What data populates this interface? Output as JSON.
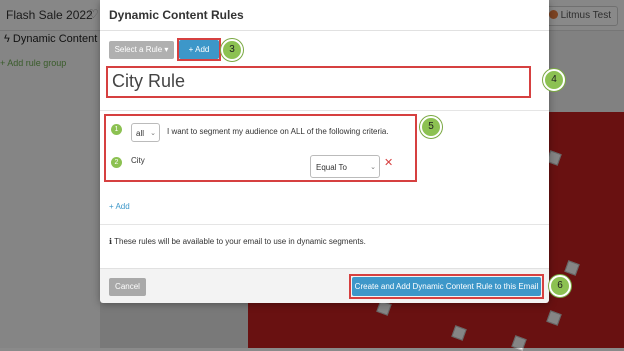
{
  "background": {
    "title": "Flash Sale 2022",
    "left_heading": "Dynamic Content",
    "add_rule_group": "Add rule group",
    "litmus_label": "Litmus Test"
  },
  "modal": {
    "title": "Dynamic Content Rules",
    "select_rule_label": "Select a Rule",
    "add_label": "Add",
    "rule_name": "City Rule",
    "match_value": "all",
    "criteria_text": "I want to segment my audience on ALL of the following criteria.",
    "condition": {
      "field": "City",
      "operator": "Equal To"
    },
    "add_condition_label": "Add",
    "info_text": "These rules will be available to your email to use in dynamic segments.",
    "cancel_label": "Cancel",
    "create_label": "Create and Add Dynamic Content Rule to this Email"
  },
  "steps": [
    "1",
    "2"
  ],
  "callouts": [
    "3",
    "4",
    "5",
    "6"
  ],
  "colors": {
    "accent": "#3d97c9",
    "callout": "#8cc152",
    "highlight": "#d64040"
  }
}
